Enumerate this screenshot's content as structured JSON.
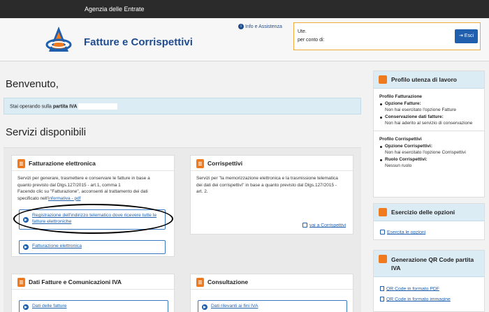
{
  "topbar": {
    "agency": "Agenzia delle Entrate"
  },
  "header": {
    "app_title": "Fatture e Corrispettivi",
    "info_link": "Info e Assistenza"
  },
  "user": {
    "user_label": "Ute.",
    "on_behalf_label": "per conto di:",
    "exit_button": "Esci"
  },
  "main": {
    "welcome": "Benvenuto,",
    "notice_prefix": "Stai operando sulla",
    "notice_bold": "partita IVA",
    "services_title": "Servizi disponibili"
  },
  "cards": {
    "fatturazione": {
      "title": "Fatturazione elettronica",
      "line1": "Servizi per generare, trasmettere e conservare le fatture in base a",
      "line2": "quanto previsto dal Dlgs.127/2015 - art.1, comma 1",
      "line3": "Facendo clic su \"Fatturazione\", acconsenti al trattamento dei dati",
      "line4_prefix": "specificato nell'",
      "line4_link": "informativa - pdf",
      "btn_registrazione": "Registrazione dell'indirizzo telematico dove ricevere tutte le fatture elettroniche",
      "btn_fatturazione": "Fatturazione elettronica"
    },
    "corrispettivi": {
      "title": "Corrispettivi",
      "line1": "Servizi per \"la memorizzazione elettronica e la trasmissione telematica",
      "line2": "dei dati dei corrispettivi\" in base a quanto previsto dal Dlgs.127/2015 -",
      "line3": "art. 2.",
      "link": "vai a Corrispettivi"
    },
    "dati_fatture": {
      "title": "Dati Fatture e Comunicazioni IVA",
      "btn": "Dati delle fatture"
    },
    "consultazione": {
      "title": "Consultazione",
      "btn": "Dati rilevanti ai fini IVA"
    }
  },
  "sidebar": {
    "profile_title": "Profilo utenza di lavoro",
    "fatt_title": "Profilo Fatturazione",
    "opz_fatture_label": "Opzione Fatture:",
    "opz_fatture_value": "Non hai esercitato l'opzione Fatture",
    "cons_label": "Conservazione dati fatture:",
    "cons_value": "Non hai aderito al servizio di conservazione",
    "corr_title": "Profilo Corrispettivi",
    "opz_corr_label": "Opzione Corrispettivi:",
    "opz_corr_value": "Non hai esercitato l'opzione Corrispettivi",
    "ruolo_label": "Ruolo Corrispettivi:",
    "ruolo_value": "Nessun ruolo",
    "opzioni_title": "Esercizio delle opzioni",
    "opzioni_link": "Esercita le opzioni",
    "qr_title": "Generazione QR Code partita IVA",
    "qr_pdf": "QR Code in formato PDF",
    "qr_img": "QR Code in formato immagine"
  }
}
